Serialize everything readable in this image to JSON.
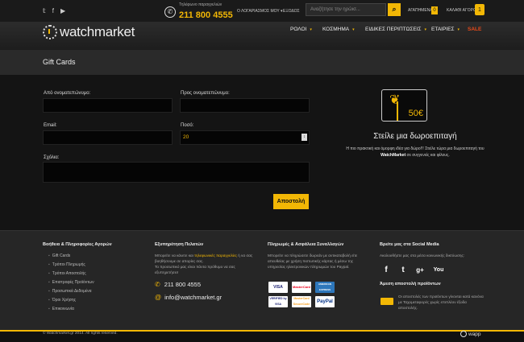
{
  "topbar": {
    "social": [
      "twitter-icon",
      "facebook-icon",
      "youtube-icon"
    ],
    "phone_label": "Τηλέφωνο παραγγελιών",
    "phone": "211 800 4555",
    "account": "Ο ΛΟΓΑΡΙΑΣΜΟΣ ΜΟΥ",
    "logout": "ΕΞΟΔΟΣ",
    "search_placeholder": "Αναζήτησε την ηρώισ...",
    "wishlist": "ΑΓΑΠΗΜΕΝΑ",
    "wishlist_count": "0",
    "cart": "ΚΑΛΑΘΙ ΑΓΟΡΩΝ",
    "cart_count": "1"
  },
  "header": {
    "logo": "watchmarket",
    "nav": [
      "ΡΟΛΟΙ",
      "ΚΟΣΜΗΜΑ",
      "ΕΙΔΙΚΕΣ ΠΕΡΙΠΤΩΣΕΙΣ",
      "ΕΤΑΙΡΙΕΣ",
      "SALE"
    ]
  },
  "page": {
    "title": "Gift Cards"
  },
  "form": {
    "from_label": "Από ονοματεπώνυμο:",
    "to_label": "Προς ονοματεπώνυμο:",
    "email_label": "Email:",
    "amount_label": "Ποσό:",
    "amount_value": "20",
    "comments_label": "Σχόλια:",
    "submit": "Αποστολή"
  },
  "promo": {
    "card_amount": "50€",
    "heading": "Στείλε μια δωροεπιταγή",
    "text1": "Η πιο πρακτική και όμορφη ιδέα για δώρο!!! Στείλε τώρα μια δωροεπιταγή του",
    "brand": "WatchMarket",
    "text2": " σε συγγενείς και φίλους."
  },
  "footer": {
    "help_heading": "Βοήθεια & Πληροφορίες Αγορών",
    "help_links": [
      "Gift Cards",
      "Τρόποι Πληρωμής",
      "Τρόποι Αποστολής",
      "Επιστροφές Προϊόντων",
      "Προσωπικά Δεδομένα",
      "Όροι Χρήσης",
      "Επικοινωνία"
    ],
    "service_heading": "Εξυπηρέτηση Πελατών",
    "service_text_a": "Μπορείτε να κάνετε και ",
    "service_text_hl": "τηλεφωνικές παραγγελίες",
    "service_text_b": " ή να σας βοηθήσουμε σε απορίες σας.",
    "service_text_c": "Το προσωπικό μας είναι πάντα πρόθυμο να σας εξυπηρετήσει!",
    "phone": "211 800 4555",
    "email": "info@watchmarket.gr",
    "pay_heading": "Πληρωμές & Ασφάλεια Συναλλαγών",
    "pay_text": "Μπορείτε να πληρώσετε δωρεάν με αντικαταβολή είτε απευθείας με χρήση πιστωτικής κάρτας ή μέσω της υπηρεσίας ηλεκτρονικών πληρωμών του Paypal.",
    "payments": [
      "VISA",
      "MasterCard",
      "AMERICAN EXPRESS",
      "VERIFIED by VISA",
      "MasterCard SecureCode",
      "PayPal"
    ],
    "social_heading": "Βρείτε μας στα Social Media",
    "social_text": "Ακολουθήστε μας στα μέσα κοινωνικής δικτύωσης:",
    "social_icons": [
      "facebook-icon",
      "twitter-icon",
      "google-plus-icon",
      "youtube-icon"
    ],
    "ship_heading": "Άμεση αποστολή προϊόντων",
    "ship_text": "Οι αποστολές των προϊόντων γίνονται κατά κανόνα με Ταχυμεταφορές χωρίς επιπλέον έξοδα αποστολής.",
    "copyright": "© Watchmarket.gr 2014. All rights reserved.",
    "credit": "wapp"
  },
  "colors": {
    "accent": "#f2b705",
    "sale": "#e84a1a",
    "background": "#141414"
  }
}
